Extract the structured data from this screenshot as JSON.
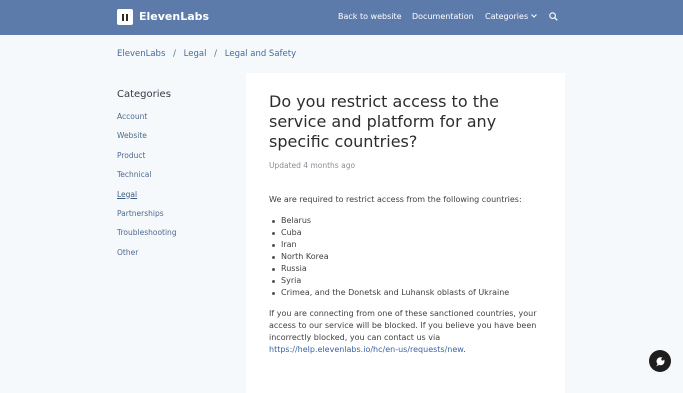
{
  "header": {
    "brand": "ElevenLabs",
    "nav": {
      "back_to_website": "Back to website",
      "documentation": "Documentation",
      "categories": "Categories"
    },
    "colors": {
      "bar": "#5c7bab"
    }
  },
  "breadcrumb": {
    "items": [
      "ElevenLabs",
      "Legal",
      "Legal and Safety"
    ],
    "separator": "/"
  },
  "sidebar": {
    "title": "Categories",
    "active": "Legal",
    "items": [
      {
        "label": "Account"
      },
      {
        "label": "Website"
      },
      {
        "label": "Product"
      },
      {
        "label": "Technical"
      },
      {
        "label": "Legal"
      },
      {
        "label": "Partnerships"
      },
      {
        "label": "Troubleshooting"
      },
      {
        "label": "Other"
      }
    ]
  },
  "article": {
    "title": "Do you restrict access to the service and platform for any specific countries?",
    "updated": "Updated 4 months ago",
    "intro": "We are required to restrict access from the following countries:",
    "countries": [
      "Belarus",
      "Cuba",
      "Iran",
      "North Korea",
      "Russia",
      "Syria",
      "Crimea, and the Donetsk and Luhansk oblasts of Ukraine"
    ],
    "notice_text": "If you are connecting from one of these sanctioned countries, your access to our service will be blocked. If you believe you have been incorrectly blocked, you can contact us via ",
    "help_link": "https://help.elevenlabs.io/hc/en-us/requests/new",
    "notice_end": "."
  },
  "widgets": {
    "chat_icon": "chat-bubble-icon",
    "search_icon": "search-icon"
  }
}
